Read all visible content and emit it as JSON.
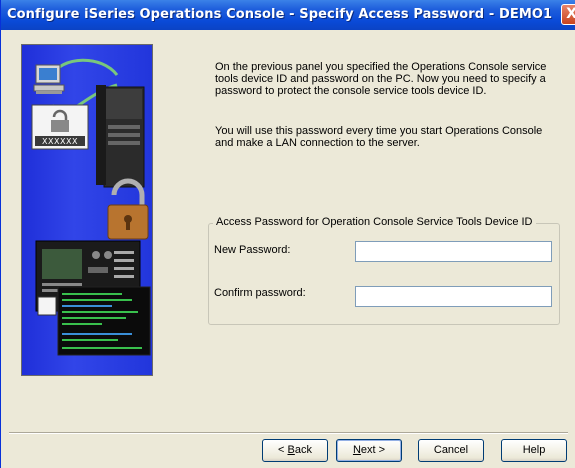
{
  "window": {
    "title": "Configure iSeries Operations Console - Specify Access Password - DEMO1",
    "close_glyph": "X"
  },
  "illustration": {
    "password_mask": "XXXXXX"
  },
  "body": {
    "paragraph1": "On the previous panel you specified the Operations Console service tools device ID and password on the PC.  Now you need to specify a password to protect the console service tools device ID.",
    "paragraph2": "You will use this password every time you start Operations Console and make a LAN connection to the server."
  },
  "group": {
    "legend": "Access Password for Operation Console Service Tools Device ID",
    "new_password_label": "New Password:",
    "new_password_value": "",
    "confirm_password_label": "Confirm password:",
    "confirm_password_value": ""
  },
  "buttons": {
    "back_prefix": "< ",
    "back_mnemonic": "B",
    "back_rest": "ack",
    "next_mnemonic": "N",
    "next_rest": "ext >",
    "cancel": "Cancel",
    "help": "Help"
  },
  "colors": {
    "title_bar": "#0a4ad8",
    "illustration_bg": "#2236dc",
    "dialog_bg": "#ece9d8"
  }
}
